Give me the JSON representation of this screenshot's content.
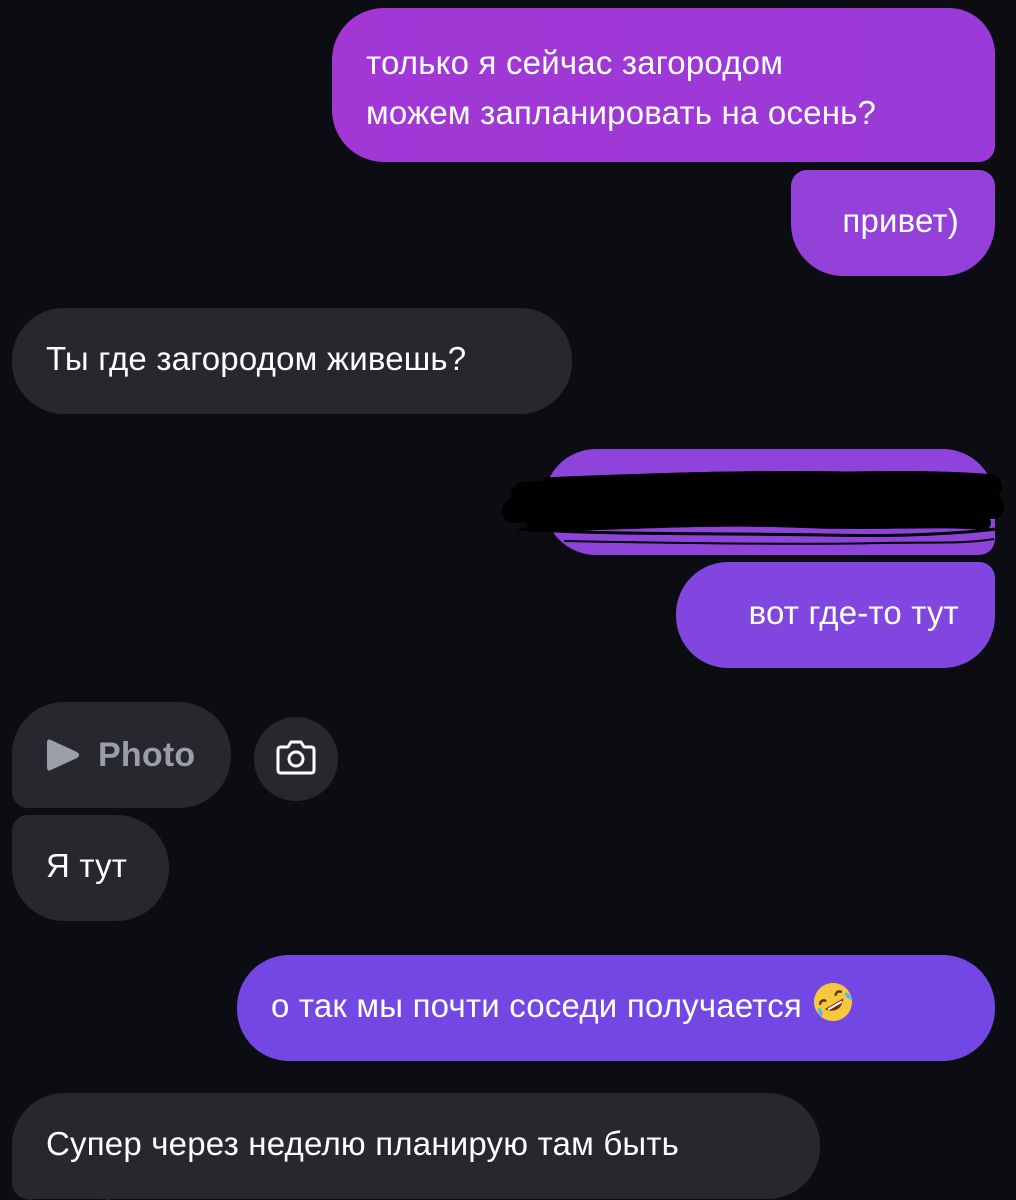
{
  "messages": [
    {
      "direction": "outgoing",
      "text": "только я сейчас загородом\nможем запланировать на осень?"
    },
    {
      "direction": "outgoing",
      "text": "привет)"
    },
    {
      "direction": "incoming",
      "text": "Ты где загородом живешь?"
    },
    {
      "direction": "outgoing",
      "text": "",
      "redacted": true
    },
    {
      "direction": "outgoing",
      "text": "вот где-то тут"
    },
    {
      "direction": "incoming",
      "type": "photo",
      "label": "Photo"
    },
    {
      "direction": "incoming",
      "text": "Я тут"
    },
    {
      "direction": "outgoing",
      "text": "о так мы почти соседи получается",
      "emoji": "rolling-on-the-floor-laughing"
    },
    {
      "direction": "incoming",
      "text": "Супер через неделю планирую там быть"
    }
  ],
  "icons": {
    "photo_play": "play-icon",
    "camera": "camera-icon"
  },
  "colors": {
    "background": "#0c0d12",
    "incoming_bubble": "#26282d",
    "outgoing_purple": "#9a3ad8",
    "outgoing_violet": "#7347e4"
  }
}
